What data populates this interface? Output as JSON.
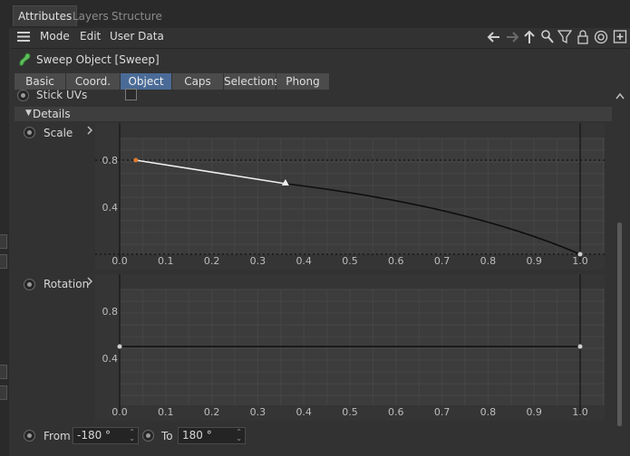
{
  "panel_tabs": [
    "Attributes",
    "Layers",
    "Structure"
  ],
  "menu": [
    "Mode",
    "Edit",
    "User Data"
  ],
  "object_title": "Sweep Object [Sweep]",
  "object_tabs": [
    "Basic",
    "Coord.",
    "Object",
    "Caps",
    "Selections",
    "Phong"
  ],
  "active_object_tab": "Object",
  "stick_uvs_label": "Stick UVs",
  "stick_uvs_checked": false,
  "details_label": "Details",
  "scale_label": "Scale",
  "rotation_label": "Rotation",
  "from_label": "From",
  "from_value": "-180 °",
  "to_label": "To",
  "to_value": "180 °",
  "toolbar_icons": [
    "back-arrow-icon",
    "forward-arrow-icon",
    "up-arrow-icon",
    "search-icon",
    "filter-icon",
    "lock-icon",
    "target-icon",
    "add-icon"
  ],
  "chart_data": [
    {
      "type": "line",
      "name": "Scale",
      "x_ticks": [
        "0.0",
        "0.1",
        "0.2",
        "0.3",
        "0.4",
        "0.5",
        "0.6",
        "0.7",
        "0.8",
        "0.9",
        "1.0"
      ],
      "y_ticks": [
        "0.4",
        "0.8"
      ],
      "xlim": [
        0,
        1
      ],
      "ylim": [
        0,
        1
      ],
      "points": [
        [
          0.035,
          0.8
        ],
        [
          0.36,
          0.6
        ],
        [
          1.0,
          0.0
        ]
      ],
      "grid": true
    },
    {
      "type": "line",
      "name": "Rotation",
      "x_ticks": [
        "0.0",
        "0.1",
        "0.2",
        "0.3",
        "0.4",
        "0.5",
        "0.6",
        "0.7",
        "0.8",
        "0.9",
        "1.0"
      ],
      "y_ticks": [
        "0.4",
        "0.8"
      ],
      "xlim": [
        0,
        1
      ],
      "ylim": [
        0,
        1
      ],
      "points": [
        [
          0.0,
          0.5
        ],
        [
          1.0,
          0.5
        ]
      ],
      "grid": true
    }
  ]
}
